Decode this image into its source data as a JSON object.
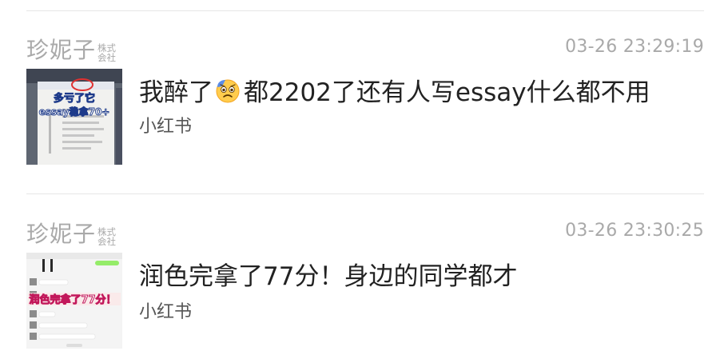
{
  "feed": [
    {
      "author": "珍妮子",
      "author_suffix_top": "株式",
      "author_suffix_bottom": "会社",
      "timestamp": "03-26 23:29:19",
      "title_before_emoji": "我醉了",
      "emoji": "anxious-sweat-face",
      "title_after_emoji": "都2202了还有人写essay什么都不用",
      "source": "小红书",
      "thumb_caption_top": "多亏了它",
      "thumb_caption_bottom": "essay稳拿70+"
    },
    {
      "author": "珍妮子",
      "author_suffix_top": "株式",
      "author_suffix_bottom": "会社",
      "timestamp": "03-26 23:30:25",
      "title": "润色完拿了77分！身边的同学都才",
      "source": "小红书",
      "thumb_caption": "润色完拿了77分！"
    }
  ],
  "colors": {
    "meta_gray": "#a9a9a9",
    "title": "#222222",
    "source": "#555555",
    "divider": "#e6e6e6"
  }
}
